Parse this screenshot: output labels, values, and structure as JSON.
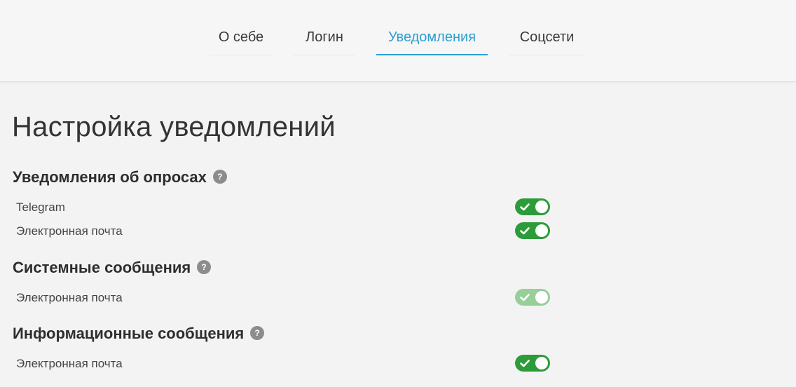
{
  "tabs": [
    {
      "label": "О себе",
      "active": false
    },
    {
      "label": "Логин",
      "active": false
    },
    {
      "label": "Уведомления",
      "active": true
    },
    {
      "label": "Соцсети",
      "active": false
    }
  ],
  "page_title": "Настройка уведомлений",
  "sections": [
    {
      "title": "Уведомления об опросах",
      "help_icon": "?",
      "rows": [
        {
          "label": "Telegram",
          "enabled": true,
          "disabled": false
        },
        {
          "label": "Электронная почта",
          "enabled": true,
          "disabled": false
        }
      ]
    },
    {
      "title": "Системные сообщения",
      "help_icon": "?",
      "rows": [
        {
          "label": "Электронная почта",
          "enabled": true,
          "disabled": true
        }
      ]
    },
    {
      "title": "Информационные сообщения",
      "help_icon": "?",
      "rows": [
        {
          "label": "Электронная почта",
          "enabled": true,
          "disabled": false
        }
      ]
    }
  ],
  "colors": {
    "accent": "#2a9fd0",
    "toggle_on": "#2e9b3a",
    "toggle_disabled": "#97cf99"
  }
}
